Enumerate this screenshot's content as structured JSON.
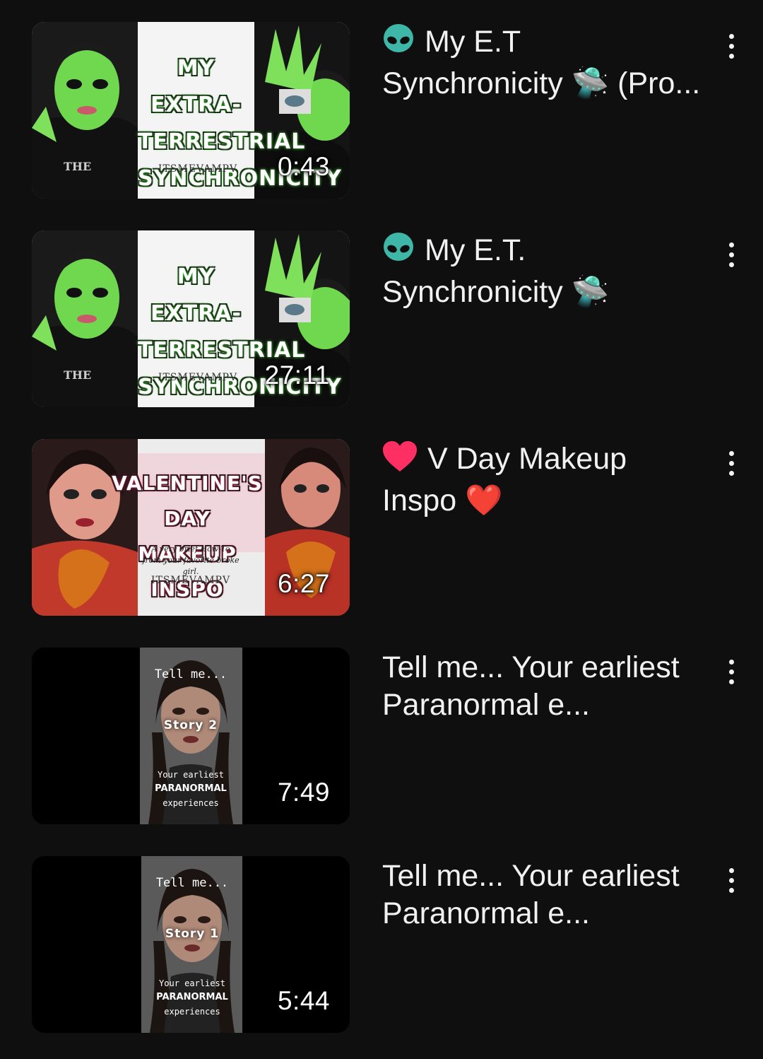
{
  "videos": [
    {
      "title": "My E.T Synchronicity 🛸 (Pro...",
      "title_prefix_icon": "alien-icon",
      "duration": "0:43",
      "thumbnail_text": [
        "MY EXTRA-",
        "TERRESTRIAL",
        "SYNCHRONICITY",
        "ITSMEVAMPV",
        "THE"
      ],
      "theme_color": "#6ee04f"
    },
    {
      "title": "My E.T. Synchronicity 🛸",
      "title_prefix_icon": "alien-icon",
      "duration": "27:11",
      "thumbnail_text": [
        "MY EXTRA-",
        "TERRESTRIAL",
        "SYNCHRONICITY",
        "ITSMEVAMPV",
        "THE"
      ],
      "theme_color": "#6ee04f"
    },
    {
      "title": "V Day Makeup Inspo ❤️",
      "title_prefix_icon": "heart-icon",
      "duration": "6:27",
      "thumbnail_text": [
        "VALENTINE'S DAY",
        "MAKEUP INSPO",
        "A very brief How-To",
        "from your favorite broke girl.",
        "ITSMEVAMPV"
      ],
      "theme_color": "#e0305a"
    },
    {
      "title": "Tell me... Your earliest Paranormal e...",
      "duration": "7:49",
      "thumbnail_text": [
        "Tell me...",
        "Story 2",
        "Your earliest",
        "PARANORMAL",
        "experiences"
      ]
    },
    {
      "title": "Tell me... Your earliest Paranormal e...",
      "duration": "5:44",
      "thumbnail_text": [
        "Tell me...",
        "Story 1",
        "Your earliest",
        "PARANORMAL",
        "experiences"
      ]
    }
  ],
  "menu_icon": "more-vert-icon"
}
